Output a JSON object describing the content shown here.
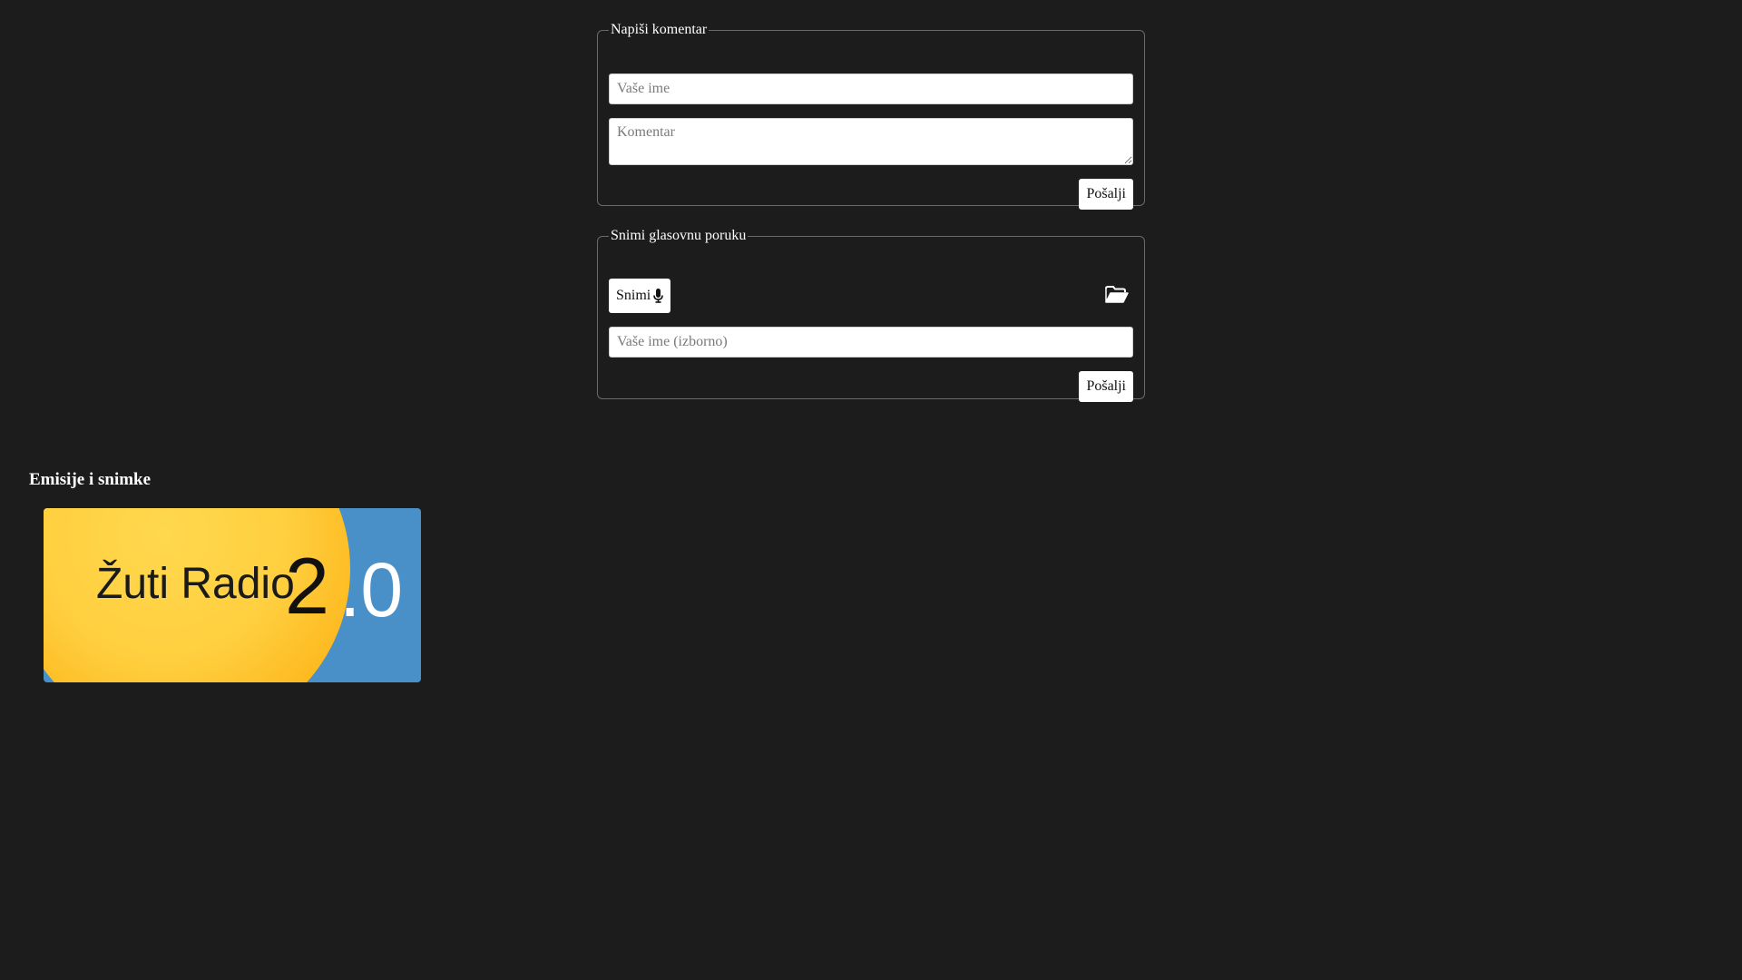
{
  "comment_form": {
    "legend": "Napiši komentar",
    "name_placeholder": "Vaše ime",
    "comment_placeholder": "Komentar",
    "send_label": "Pošalji"
  },
  "voice_form": {
    "legend": "Snimi glasovnu poruku",
    "record_label": "Snimi",
    "record_icon": "microphone-icon",
    "upload_icon": "folder-open-icon",
    "name_placeholder": "Vaše ime (izborno)",
    "send_label": "Pošalji"
  },
  "shows": {
    "heading": "Emisije i snimke",
    "items": [
      {
        "logo_text": "Žuti Radio",
        "logo_number": "2",
        "logo_suffix": ".0"
      }
    ]
  },
  "colors": {
    "background": "#1c1c1c",
    "logo_yellow": "#ffcf3f",
    "logo_blue": "#4a90c8"
  }
}
